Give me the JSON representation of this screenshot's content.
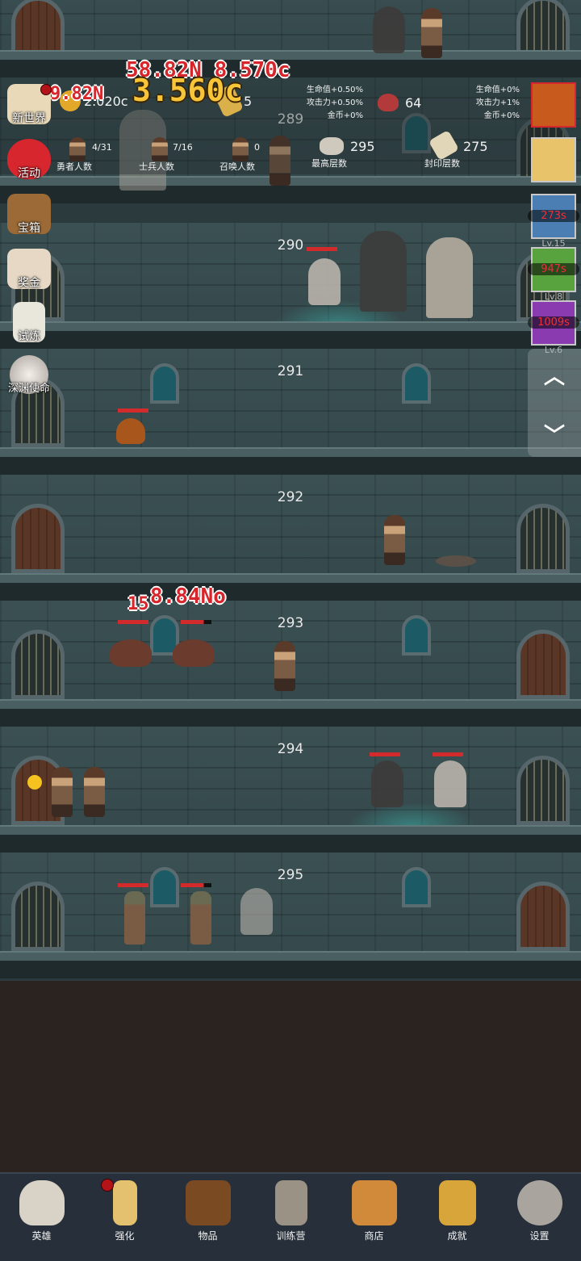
{
  "damage_popups": {
    "top_red": "58.82N 8.570c",
    "gold_big": "3.560c",
    "top_left_red": "9.82N",
    "floor293_red": "8.84No",
    "floor293_prefix": "15"
  },
  "resources": {
    "gold_value": "2.020c",
    "gold_icon": "coin-icon",
    "scroll_count": "5",
    "gem_count": "64",
    "highest_floor_value": "295",
    "highest_floor_label": "最高层数",
    "seal_floor_value": "275",
    "seal_floor_label": "封印层数"
  },
  "bonuses_left": [
    "生命值+0.50%",
    "攻击力+0.50%",
    "金币+0%"
  ],
  "bonuses_right": [
    "生命值+0%",
    "攻击力+1%",
    "金币+0%"
  ],
  "counts": {
    "heroes": {
      "value": "4/31",
      "label": "勇者人数"
    },
    "soldiers": {
      "value": "7/16",
      "label": "士兵人数"
    },
    "summons": {
      "value": "0",
      "label": "召唤人数"
    }
  },
  "side_menu": [
    {
      "label": "新世界",
      "icon": "map-icon",
      "color": "#e9d9b8"
    },
    {
      "label": "活动",
      "icon": "heart-icon",
      "color": "#d8262e"
    },
    {
      "label": "宝箱",
      "icon": "chest-icon",
      "color": "#9b6a36"
    },
    {
      "label": "奖金",
      "icon": "envelope-icon",
      "color": "#e6d8c4"
    },
    {
      "label": "试炼",
      "icon": "feather-icon",
      "color": "#e9e6dc"
    },
    {
      "label": "深渊使命",
      "icon": "orb-icon",
      "color": "#d9d2cc"
    }
  ],
  "buffs": [
    {
      "icon": "pumpkin-icon",
      "timer": "",
      "level": "",
      "color": "#c95a1e",
      "border": "#d8262e"
    },
    {
      "icon": "candle-icon",
      "timer": "",
      "level": "",
      "color": "#e8c36a",
      "border": "#cfd4dc"
    },
    {
      "icon": "sword-buff-icon",
      "timer": "273s",
      "level": "Lv.15",
      "color": "#4b7fb3",
      "border": "#cfd4dc"
    },
    {
      "icon": "shield-buff-icon",
      "timer": "947s",
      "level": "Lv.8",
      "color": "#58a33e",
      "border": "#cfd4dc"
    },
    {
      "icon": "potion-buff-icon",
      "timer": "1009s",
      "level": "Lv.6",
      "color": "#8a3bb0",
      "border": "#cfd4dc"
    }
  ],
  "floors": [
    {
      "number": "289"
    },
    {
      "number": "290"
    },
    {
      "number": "291"
    },
    {
      "number": "292"
    },
    {
      "number": "293"
    },
    {
      "number": "294"
    },
    {
      "number": "295"
    }
  ],
  "scroll_controls": {
    "up": "^",
    "down": "v"
  },
  "bottom_nav": [
    {
      "label": "英雄",
      "icon": "skull-icon",
      "color": "#d9d2c6"
    },
    {
      "label": "强化",
      "icon": "candle-icon",
      "color": "#e4c16e"
    },
    {
      "label": "物品",
      "icon": "book-icon",
      "color": "#7a4a22"
    },
    {
      "label": "训练营",
      "icon": "lantern-icon",
      "color": "#9a9385"
    },
    {
      "label": "商店",
      "icon": "mug-icon",
      "color": "#d08a3a"
    },
    {
      "label": "成就",
      "icon": "key-icon",
      "color": "#d8a53a"
    },
    {
      "label": "设置",
      "icon": "gear-icon",
      "color": "#a9a59e"
    }
  ]
}
